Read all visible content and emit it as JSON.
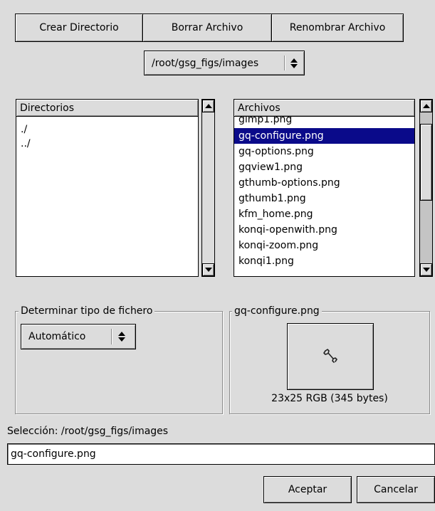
{
  "toolbar": {
    "create_dir": "Crear Directorio",
    "delete_file": "Borrar Archivo",
    "rename_file": "Renombrar Archivo"
  },
  "path_combo": {
    "value": "/root/gsg_figs/images"
  },
  "directories": {
    "header": "Directorios",
    "items": [
      "./",
      "../"
    ]
  },
  "files": {
    "header": "Archivos",
    "partial_item": "gimp1.png",
    "items": [
      "gq-configure.png",
      "gq-options.png",
      "gqview1.png",
      "gthumb-options.png",
      "gthumb1.png",
      "kfm_home.png",
      "konqi-openwith.png",
      "konqi-zoom.png",
      "konqi1.png"
    ],
    "selected": "gq-configure.png"
  },
  "filetype": {
    "legend": "Determinar tipo de fichero",
    "value": "Automático"
  },
  "preview": {
    "legend": "gq-configure.png",
    "icon": "wrench-icon",
    "info": "23x25 RGB (345 bytes)"
  },
  "selection": {
    "label": "Selección: /root/gsg_figs/images",
    "value": "gq-configure.png"
  },
  "actions": {
    "accept": "Aceptar",
    "cancel": "Cancelar"
  },
  "colors": {
    "window_bg": "#dcdcdc",
    "selection_bg": "#0a0a8a",
    "selection_fg": "#ffffff"
  }
}
